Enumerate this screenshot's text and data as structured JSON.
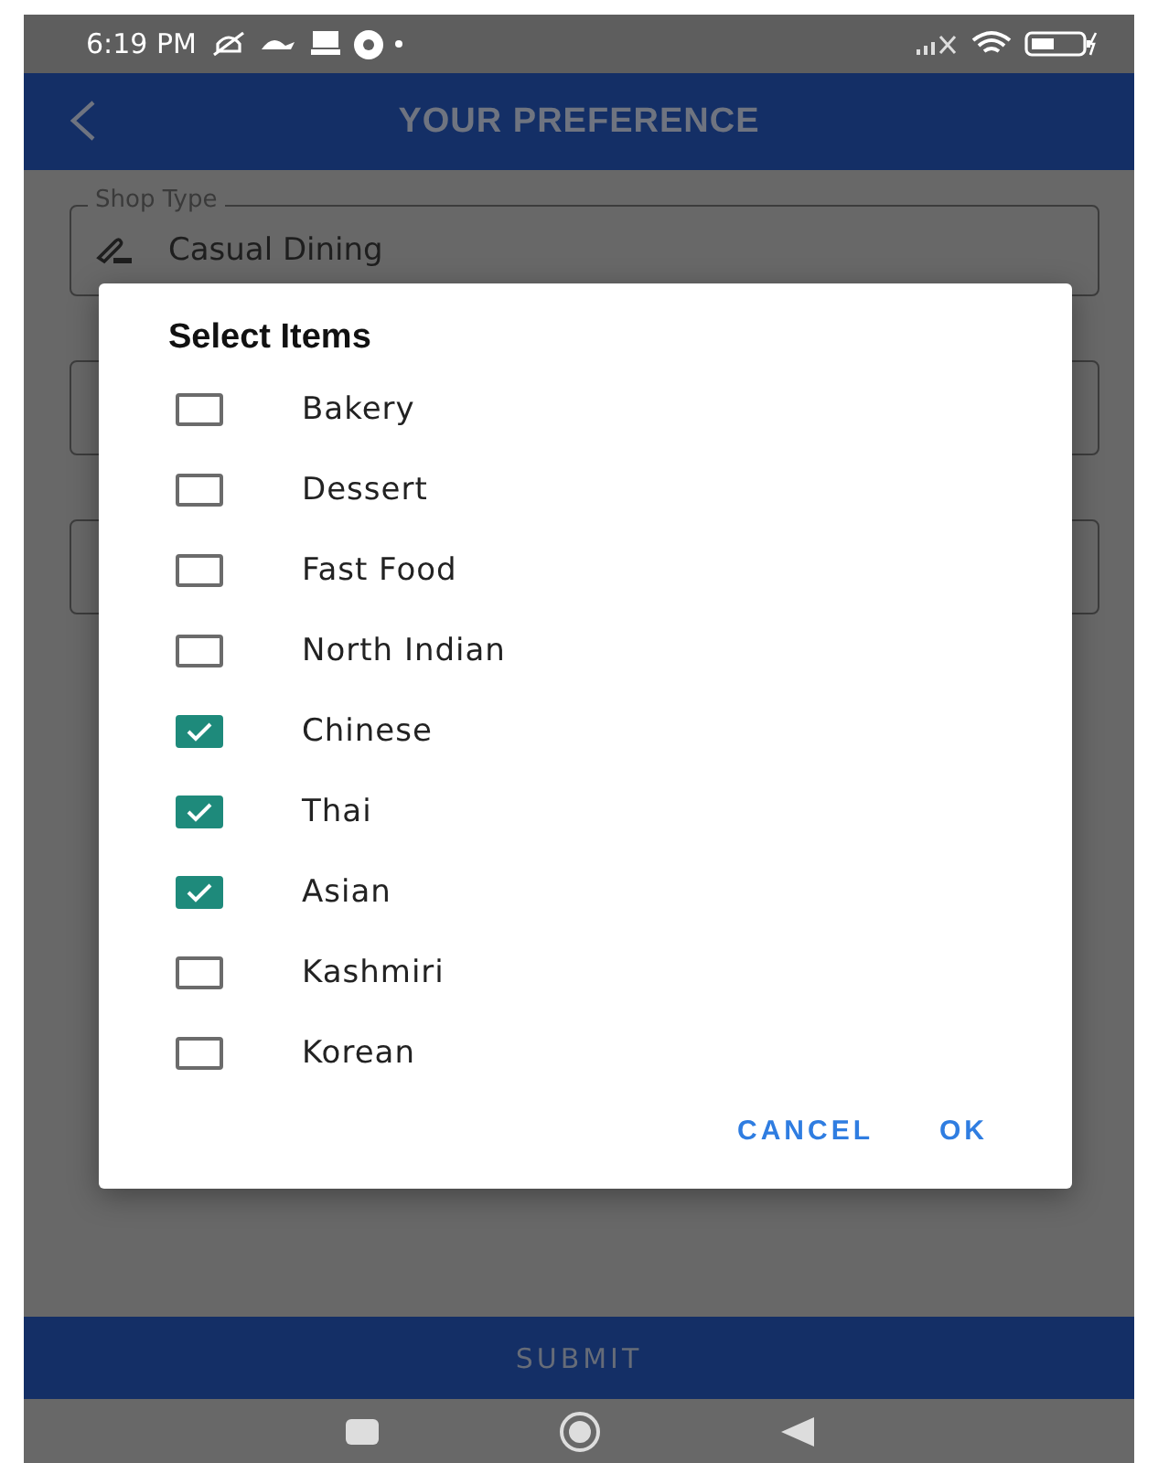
{
  "status_bar": {
    "time": "6:19 PM"
  },
  "app_bar": {
    "title": "YOUR PREFERENCE"
  },
  "form": {
    "shop_type": {
      "label": "Shop Type",
      "value": "Casual Dining"
    },
    "other_fields": [
      {
        "kind": "text"
      },
      {
        "kind": "text"
      }
    ]
  },
  "dialog": {
    "title": "Select Items",
    "items": [
      {
        "label": "Bakery",
        "checked": false
      },
      {
        "label": "Dessert",
        "checked": false
      },
      {
        "label": "Fast Food",
        "checked": false
      },
      {
        "label": "North Indian",
        "checked": false
      },
      {
        "label": "Chinese",
        "checked": true
      },
      {
        "label": "Thai",
        "checked": true
      },
      {
        "label": "Asian",
        "checked": true
      },
      {
        "label": "Kashmiri",
        "checked": false
      },
      {
        "label": "Korean",
        "checked": false
      }
    ],
    "buttons": [
      "CANCEL",
      "OK"
    ]
  },
  "submit": {
    "label": "SUBMIT"
  }
}
